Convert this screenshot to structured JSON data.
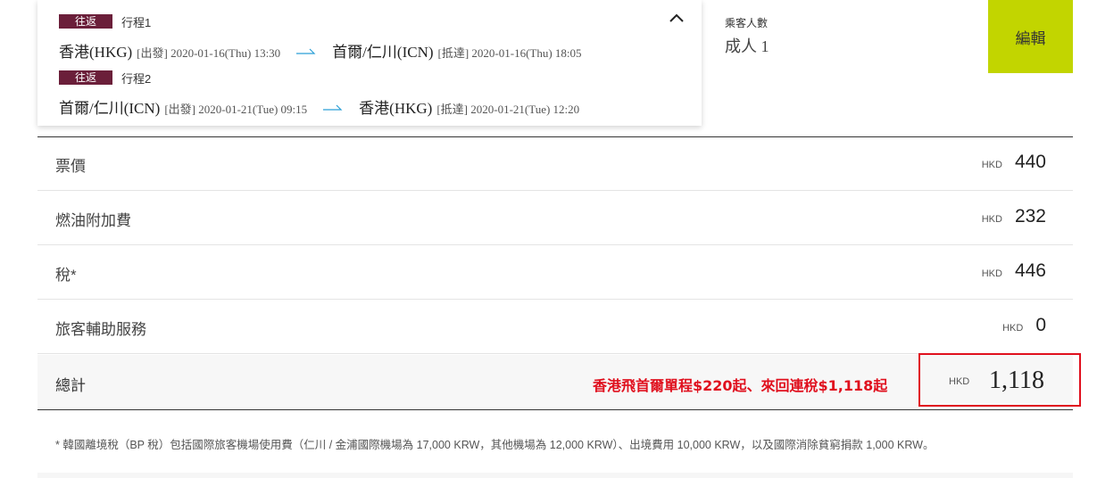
{
  "itinerary": {
    "trips": [
      {
        "badge": "往返",
        "label": "行程1",
        "from_city": "香港(HKG)",
        "from_meta": "[出發] 2020-01-16(Thu) 13:30",
        "to_city": "首爾/仁川(ICN)",
        "to_meta": "[抵達] 2020-01-16(Thu) 18:05"
      },
      {
        "badge": "往返",
        "label": "行程2",
        "from_city": "首爾/仁川(ICN)",
        "from_meta": "[出發] 2020-01-21(Tue) 09:15",
        "to_city": "香港(HKG)",
        "to_meta": "[抵達] 2020-01-21(Tue) 12:20"
      }
    ],
    "collapse_icon": "chevron-up-icon",
    "arrow_icon": "flight-arrow-icon"
  },
  "passengers": {
    "label": "乘客人數",
    "value": "成人 1"
  },
  "edit_button": "編輯",
  "fare_rows": [
    {
      "label": "票價",
      "currency": "HKD",
      "amount": "440"
    },
    {
      "label": "燃油附加費",
      "currency": "HKD",
      "amount": "232"
    },
    {
      "label": "稅*",
      "currency": "HKD",
      "amount": "446"
    },
    {
      "label": "旅客輔助服務",
      "currency": "HKD",
      "amount": "0"
    }
  ],
  "total": {
    "label": "總計",
    "promo": "香港飛首爾單程$220起、來回連稅$1,118起",
    "currency": "HKD",
    "amount": "1,118"
  },
  "footnote": "* 韓國離境稅（BP 稅）包括國際旅客機場使用費（仁川 / 金浦國際機場為 17,000 KRW，其他機場為 12,000 KRW）、出境費用 10,000 KRW，以及國際消除貧窮捐款 1,000 KRW。",
  "colors": {
    "badge": "#6b1f3a",
    "edit_button": "#c2d500",
    "arrow": "#2a9fd6",
    "highlight": "#e0101e"
  }
}
